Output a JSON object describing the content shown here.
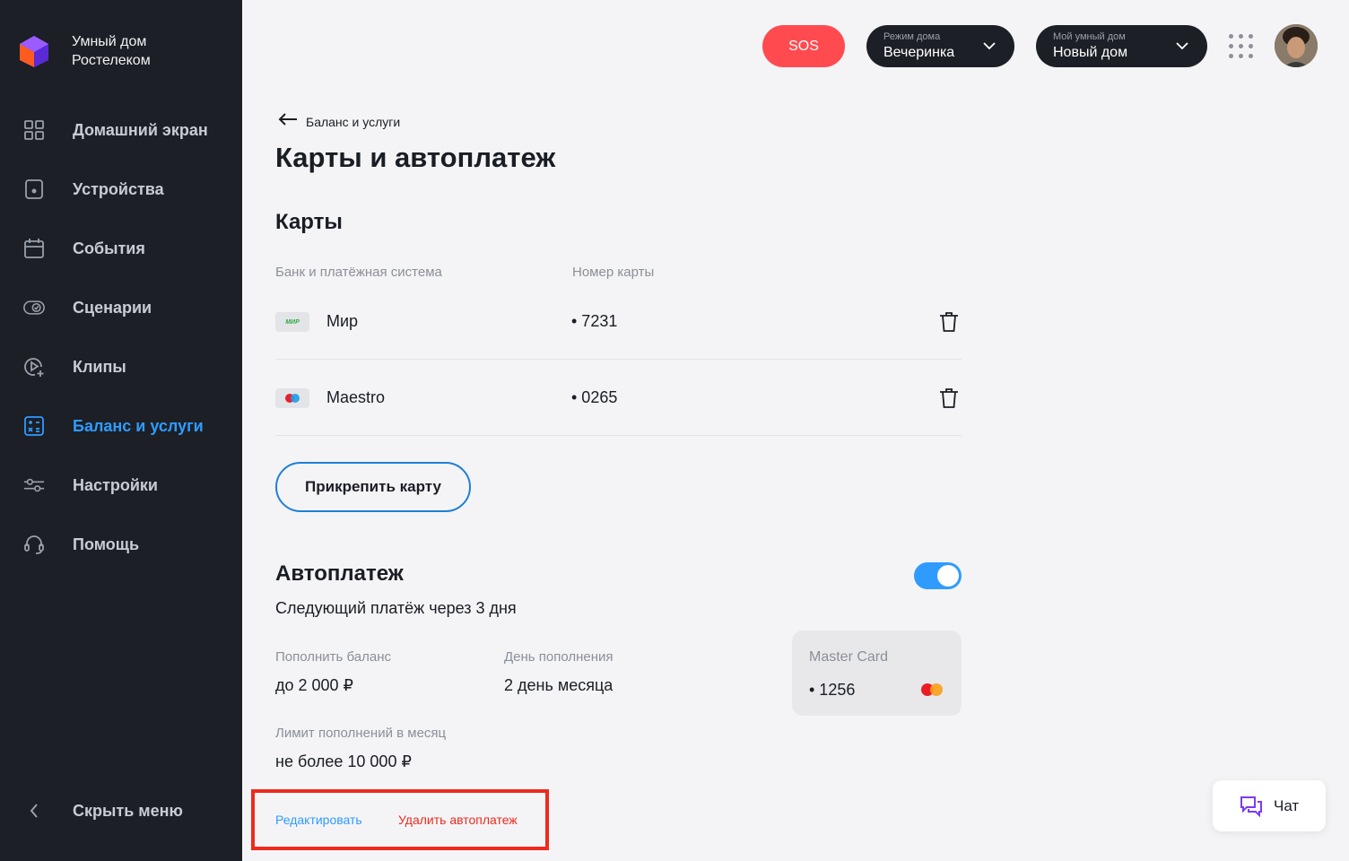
{
  "brand": {
    "line1": "Умный дом",
    "line2": "Ростелеком"
  },
  "sidebar": {
    "items": [
      {
        "label": "Домашний экран",
        "icon": "grid-icon"
      },
      {
        "label": "Устройства",
        "icon": "device-icon"
      },
      {
        "label": "События",
        "icon": "calendar-icon"
      },
      {
        "label": "Сценарии",
        "icon": "scenario-icon"
      },
      {
        "label": "Клипы",
        "icon": "clips-icon"
      },
      {
        "label": "Баланс и услуги",
        "icon": "balance-icon",
        "active": true
      },
      {
        "label": "Настройки",
        "icon": "settings-sliders-icon"
      },
      {
        "label": "Помощь",
        "icon": "headset-icon"
      }
    ],
    "hide_label": "Скрыть меню"
  },
  "topbar": {
    "sos": "SOS",
    "mode": {
      "caption": "Режим дома",
      "value": "Вечеринка"
    },
    "home": {
      "caption": "Мой умный дом",
      "value": "Новый дом"
    }
  },
  "breadcrumb": "Баланс и услуги",
  "page_title": "Карты и автоплатеж",
  "cards": {
    "title": "Карты",
    "col_bank": "Банк и платёжная система",
    "col_number": "Номер карты",
    "rows": [
      {
        "name": "Мир",
        "number": "• 7231",
        "logo_text": "МИР"
      },
      {
        "name": "Maestro",
        "number": "• 0265"
      }
    ],
    "attach_label": "Прикрепить карту"
  },
  "autopay": {
    "title": "Автоплатеж",
    "enabled": true,
    "next": "Следующий платёж через 3 дня",
    "topup_label": "Пополнить баланс",
    "topup_value": "до 2 000 ₽",
    "day_label": "День пополнения",
    "day_value": "2 день месяца",
    "limit_label": "Лимит пополнений в месяц",
    "limit_value": "не более 10 000 ₽",
    "card": {
      "name": "Master Card",
      "number": "• 1256"
    },
    "edit_label": "Редактировать",
    "remove_label": "Удалить автоплатеж"
  },
  "chat": {
    "label": "Чат"
  },
  "colors": {
    "accent": "#2f9bff",
    "danger": "#ee2a1e",
    "sos": "#ff4b4f",
    "sidebar": "#1c1f26"
  }
}
